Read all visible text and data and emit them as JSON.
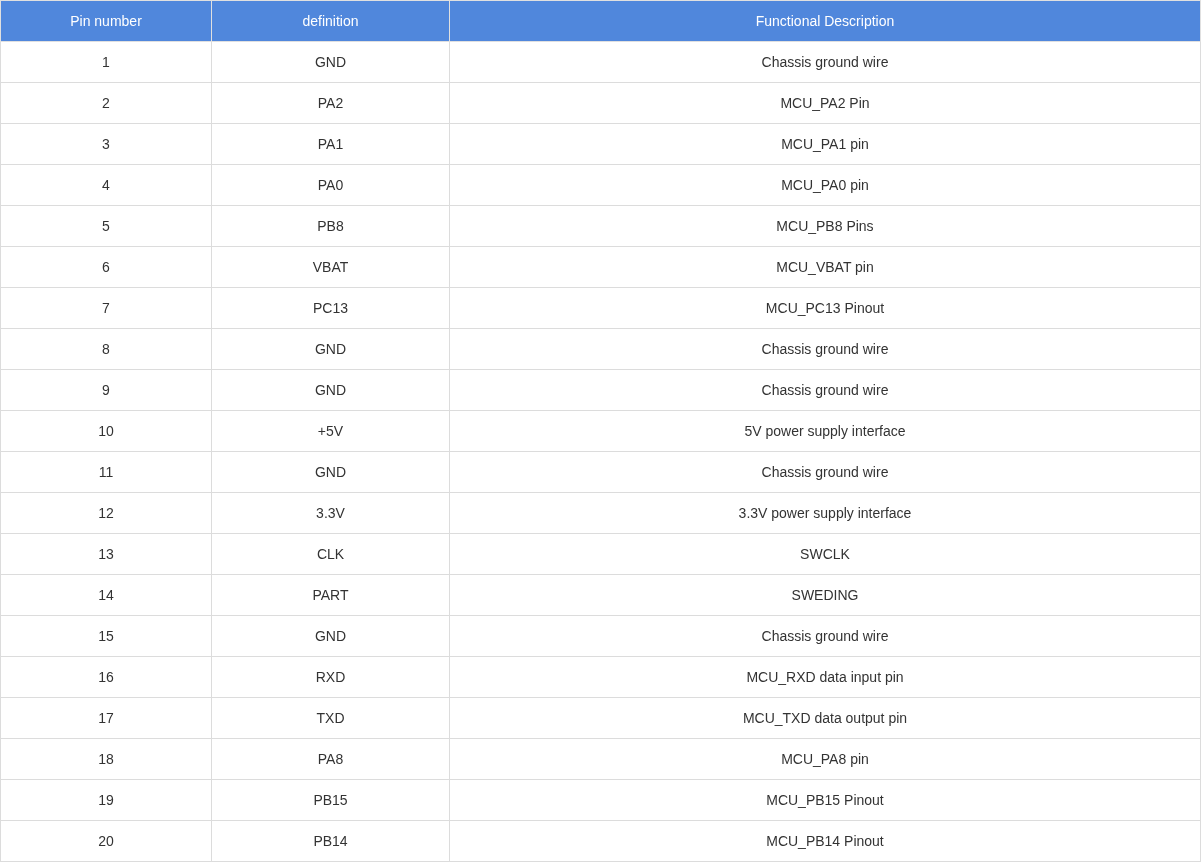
{
  "table": {
    "columns": [
      "Pin number",
      "definition",
      "Functional Description"
    ],
    "rows": [
      [
        "1",
        "GND",
        "Chassis ground wire"
      ],
      [
        "2",
        "PA2",
        "MCU_PA2 Pin"
      ],
      [
        "3",
        "PA1",
        "MCU_PA1 pin"
      ],
      [
        "4",
        "PA0",
        "MCU_PA0 pin"
      ],
      [
        "5",
        "PB8",
        "MCU_PB8 Pins"
      ],
      [
        "6",
        "VBAT",
        "MCU_VBAT pin"
      ],
      [
        "7",
        "PC13",
        "MCU_PC13 Pinout"
      ],
      [
        "8",
        "GND",
        "Chassis ground wire"
      ],
      [
        "9",
        "GND",
        "Chassis ground wire"
      ],
      [
        "10",
        "+5V",
        "5V power supply interface"
      ],
      [
        "11",
        "GND",
        "Chassis ground wire"
      ],
      [
        "12",
        "3.3V",
        "3.3V power supply interface"
      ],
      [
        "13",
        "CLK",
        "SWCLK"
      ],
      [
        "14",
        "PART",
        "SWEDING"
      ],
      [
        "15",
        "GND",
        "Chassis ground wire"
      ],
      [
        "16",
        "RXD",
        "MCU_RXD data input pin"
      ],
      [
        "17",
        "TXD",
        "MCU_TXD data output pin"
      ],
      [
        "18",
        "PA8",
        "MCU_PA8 pin"
      ],
      [
        "19",
        "PB15",
        "MCU_PB15 Pinout"
      ],
      [
        "20",
        "PB14",
        "MCU_PB14 Pinout"
      ]
    ]
  }
}
